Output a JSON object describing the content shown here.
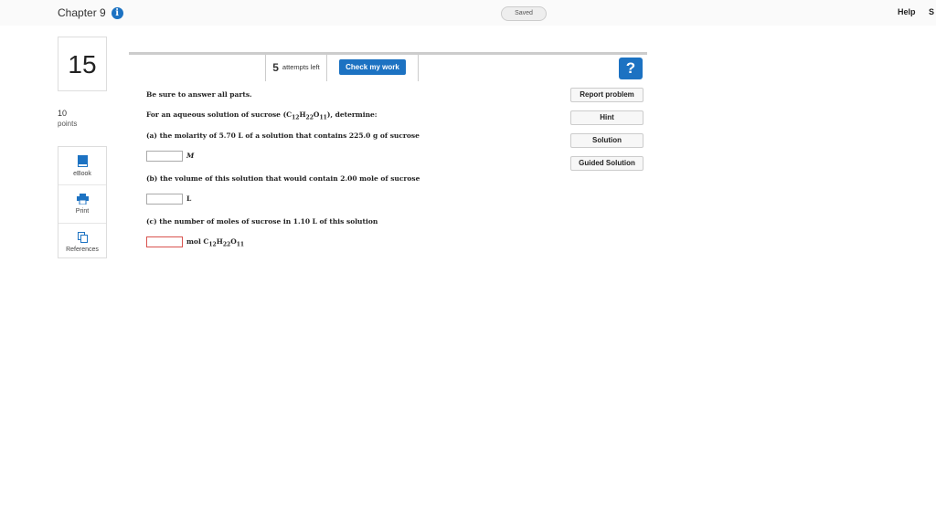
{
  "header": {
    "chapter": "Chapter 9",
    "saved": "Saved",
    "help": "Help",
    "extra": "S"
  },
  "question": {
    "number": "15",
    "points_value": "10",
    "points_label": "points"
  },
  "tools": [
    {
      "label": "eBook",
      "icon": "book-icon"
    },
    {
      "label": "Print",
      "icon": "printer-icon"
    },
    {
      "label": "References",
      "icon": "copy-icon"
    }
  ],
  "toolbar": {
    "attempts_count": "5",
    "attempts_label": "attempts left",
    "check_label": "Check my work"
  },
  "side_buttons": {
    "report": "Report problem",
    "hint": "Hint",
    "solution": "Solution",
    "guided": "Guided Solution"
  },
  "prompt": {
    "instruction": "Be sure to answer all parts.",
    "intro_pre": "For an aqueous solution of sucrose (C",
    "intro_s1": "12",
    "intro_m1": "H",
    "intro_s2": "22",
    "intro_m2": "O",
    "intro_s3": "11",
    "intro_post": "), determine:",
    "part_a": "(a) the molarity of 5.70 L of a solution that contains 225.0 g of sucrose",
    "unit_a": "M",
    "part_b": "(b) the volume of this solution that would contain 2.00 mole of sucrose",
    "unit_b": "L",
    "part_c": "(c) the number of moles of sucrose in 1.10 L of this solution",
    "unit_c_pre": "mol C",
    "unit_c_s1": "12",
    "unit_c_m1": "H",
    "unit_c_s2": "22",
    "unit_c_m2": "O",
    "unit_c_s3": "11"
  },
  "answers": {
    "a": "",
    "b": "",
    "c": ""
  },
  "colors": {
    "accent": "#1c72c2",
    "error_border": "#d9534f"
  }
}
